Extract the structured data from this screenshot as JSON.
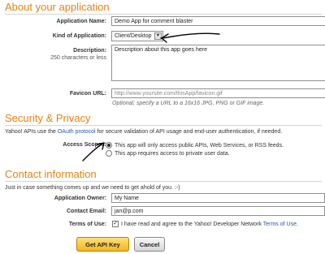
{
  "about": {
    "heading": "About your application",
    "app_name": {
      "label": "Application Name:",
      "value": "Demo App for comment blaster"
    },
    "kind": {
      "label": "Kind of Application:",
      "value": "Client/Desktop"
    },
    "description": {
      "label": "Description:",
      "hint": "250 characters or less",
      "value": "Description about this app goes here"
    },
    "favicon": {
      "label": "Favicon URL:",
      "placeholder": "http://www.yoursite.com/thisApp/favicon.gif",
      "note": "Optional; specify a URL to a 16x16 JPG, PNG or GIF image."
    }
  },
  "security": {
    "heading": "Security & Privacy",
    "intro_before": "Yahoo! APIs use the ",
    "intro_link": "OAuth protocol",
    "intro_after": " for secure validation of API usage and end-user authentication, if needed.",
    "access_label": "Access Scopes:",
    "options": [
      {
        "label": "This app will only access public APIs, Web Services, or RSS feeds.",
        "selected": true
      },
      {
        "label": "This app requires access to private user data.",
        "selected": false
      }
    ]
  },
  "contact": {
    "heading": "Contact information",
    "intro": "Just in case something comes up and we need to get ahold of you. :-)",
    "owner": {
      "label": "Application Owner:",
      "value": "My Name"
    },
    "email": {
      "label": "Contact Email:",
      "value": "jan@p.com"
    },
    "terms": {
      "label": "Terms of Use:",
      "checked": true,
      "text_before": "I have read and agree to the Yahoo! Developer Network ",
      "link": "Terms of Use",
      "text_after": "."
    }
  },
  "buttons": {
    "primary": "Get API Key",
    "secondary": "Cancel"
  },
  "colors": {
    "heading": "#e8820e",
    "link": "#2758b0",
    "primary_button": "#f2b61d"
  },
  "annotations": [
    "arrow-annotation",
    "arrow-annotation"
  ]
}
